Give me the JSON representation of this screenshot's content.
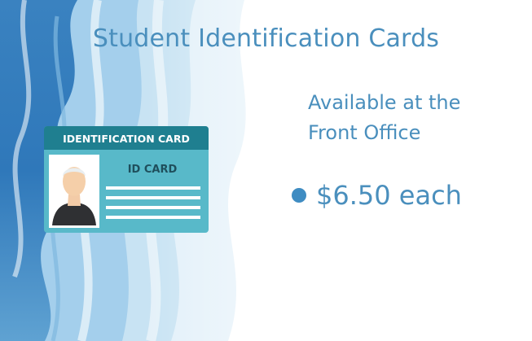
{
  "slide": {
    "title": "Student Identification Cards",
    "subtitle_line1": "Available at the",
    "subtitle_line2": "Front Office",
    "price": "$6.50 each"
  },
  "id_card": {
    "header_text": "IDENTIFICATION CARD",
    "label": "ID CARD"
  },
  "colors": {
    "title_text": "#4a8fbd",
    "bullet": "#3f8cc2",
    "card_header": "#1f7f90",
    "card_body": "#58b9c9",
    "watercolor_blue": "#2f78ba"
  },
  "icons": {
    "bullet": "dot",
    "person": "avatar-silhouette"
  }
}
